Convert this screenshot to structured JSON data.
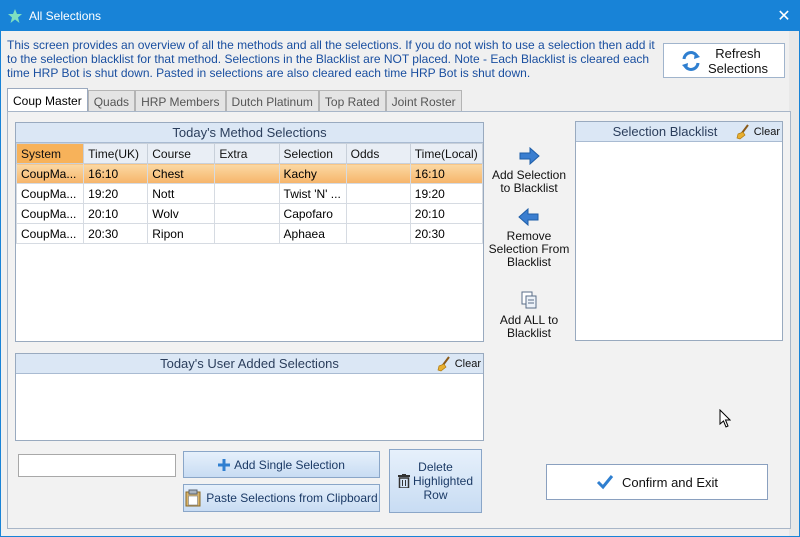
{
  "window": {
    "title": "All Selections",
    "close_glyph": "✕"
  },
  "intro_text": "This screen provides an overview of all the methods and all the selections. If you do not wish to use a selection then add it to the selection blacklist for that method. Selections in the Blacklist are NOT placed. Note - Each Blacklist is cleared each time HRP Bot is shut down. Pasted in selections are also cleared each time HRP Bot is shut down.",
  "refresh": {
    "line1": "Refresh",
    "line2": "Selections"
  },
  "tabs": [
    {
      "label": "Coup Master",
      "active": true
    },
    {
      "label": "Quads"
    },
    {
      "label": "HRP Members"
    },
    {
      "label": "Dutch Platinum"
    },
    {
      "label": "Top Rated"
    },
    {
      "label": "Joint Roster"
    }
  ],
  "method_panel": {
    "title": "Today's Method Selections",
    "columns": [
      "System",
      "Time(UK)",
      "Course",
      "Extra",
      "Selection",
      "Odds",
      "Time(Local)"
    ],
    "rows": [
      [
        "CoupMa...",
        "16:10",
        "Chest",
        "",
        "Kachy",
        "",
        "16:10"
      ],
      [
        "CoupMa...",
        "19:20",
        "Nott",
        "",
        "Twist 'N' ...",
        "",
        "19:20"
      ],
      [
        "CoupMa...",
        "20:10",
        "Wolv",
        "",
        "Capofaro",
        "",
        "20:10"
      ],
      [
        "CoupMa...",
        "20:30",
        "Ripon",
        "",
        "Aphaea",
        "",
        "20:30"
      ]
    ]
  },
  "actions": {
    "add_to_blacklist": {
      "line1": "Add Selection",
      "line2": "to Blacklist"
    },
    "remove_from_blacklist": {
      "line1": "Remove",
      "line2": "Selection From",
      "line3": "Blacklist"
    },
    "add_all": {
      "line1": "Add ALL to",
      "line2": "Blacklist"
    }
  },
  "blacklist_panel": {
    "title": "Selection Blacklist",
    "clear": "Clear"
  },
  "user_panel": {
    "title": "Today's User Added Selections",
    "clear": "Clear"
  },
  "selection_input": {
    "value": "",
    "placeholder": ""
  },
  "buttons": {
    "add_single": "Add Single Selection",
    "paste": "Paste Selections from Clipboard",
    "delete": {
      "line1": "Delete",
      "line2": "Highlighted",
      "line3": "Row"
    },
    "confirm": "Confirm and Exit"
  },
  "colors": {
    "titlebar": "#1883d7",
    "highlight": "#f6b46a",
    "accent_blue": "#2f7fd0"
  }
}
